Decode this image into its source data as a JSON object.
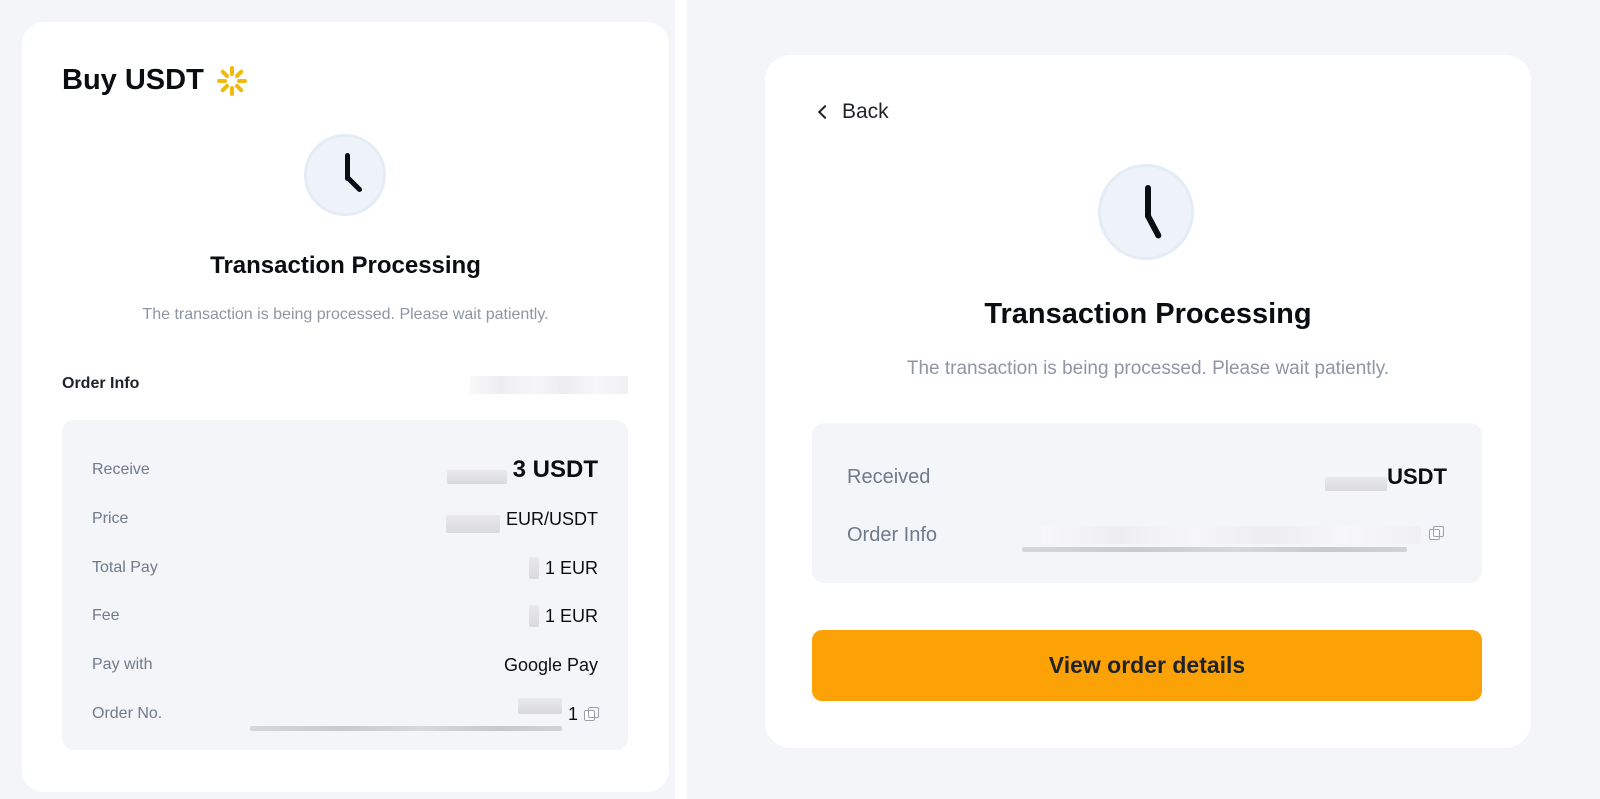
{
  "left_panel": {
    "title": "Buy USDT",
    "heading": "Transaction Processing",
    "subtitle": "The transaction is being processed. Please wait patiently.",
    "order_info_label": "Order Info",
    "rows": [
      {
        "label": "Receive",
        "value": "3 USDT"
      },
      {
        "label": "Price",
        "value": "EUR/USDT"
      },
      {
        "label": "Total Pay",
        "value": "1 EUR"
      },
      {
        "label": "Fee",
        "value": "1 EUR"
      },
      {
        "label": "Pay with",
        "value": "Google Pay"
      },
      {
        "label": "Order No.",
        "value": "1"
      }
    ],
    "icons": [
      "loading-spinner-icon",
      "clock-icon",
      "copy-icon"
    ],
    "accent_color": "#f0b90b"
  },
  "right_panel": {
    "back_label": "Back",
    "heading": "Transaction Processing",
    "subtitle": "The transaction is being processed. Please wait patiently.",
    "rows": [
      {
        "label": "Received",
        "value": "USDT"
      },
      {
        "label": "Order Info",
        "value": ""
      }
    ],
    "button_label": "View order details",
    "button_color": "#fca207",
    "icons": [
      "chevron-left-icon",
      "clock-icon",
      "copy-icon"
    ]
  }
}
